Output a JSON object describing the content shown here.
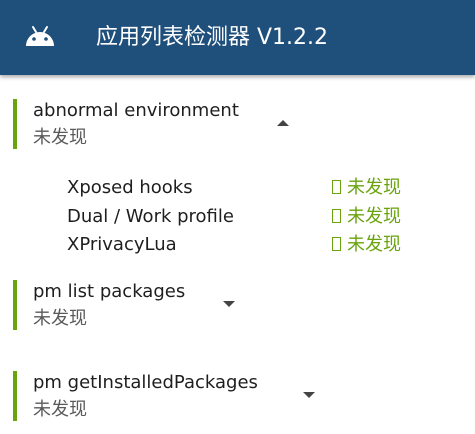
{
  "app": {
    "title": "应用列表检测器 V1.2.2",
    "icon": "android-icon",
    "colors": {
      "app_bar": "#1f4f7b",
      "accent": "#6aa30e"
    }
  },
  "sections": [
    {
      "title": "abnormal environment",
      "status": "未发现",
      "expanded": true,
      "checks": [
        {
          "label": "Xposed hooks",
          "status": "未发现"
        },
        {
          "label": "Dual / Work profile",
          "status": "未发现"
        },
        {
          "label": "XPrivacyLua",
          "status": "未发现"
        }
      ]
    },
    {
      "title": "pm list packages",
      "status": "未发现",
      "expanded": false
    },
    {
      "title": "pm getInstalledPackages",
      "status": "未发现",
      "expanded": false
    }
  ]
}
